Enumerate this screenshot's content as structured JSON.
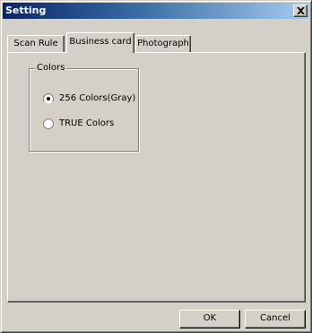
{
  "window": {
    "title": "Setting"
  },
  "tabs": [
    {
      "label": "Scan Rule",
      "active": false
    },
    {
      "label": "Business card",
      "active": true
    },
    {
      "label": "Photograph",
      "active": false
    }
  ],
  "colors_group": {
    "label": "Colors",
    "options": [
      {
        "label": "256 Colors(Gray)",
        "selected": true
      },
      {
        "label": "TRUE Colors",
        "selected": false
      }
    ]
  },
  "buttons": {
    "ok": "OK",
    "cancel": "Cancel"
  },
  "theme": {
    "titlebar_start": "#0a246a",
    "titlebar_end": "#a6caf0",
    "face": "#d4d0c8"
  },
  "icons": {
    "close": "close-icon",
    "radio_on": "radio-checked-icon",
    "radio_off": "radio-unchecked-icon"
  }
}
